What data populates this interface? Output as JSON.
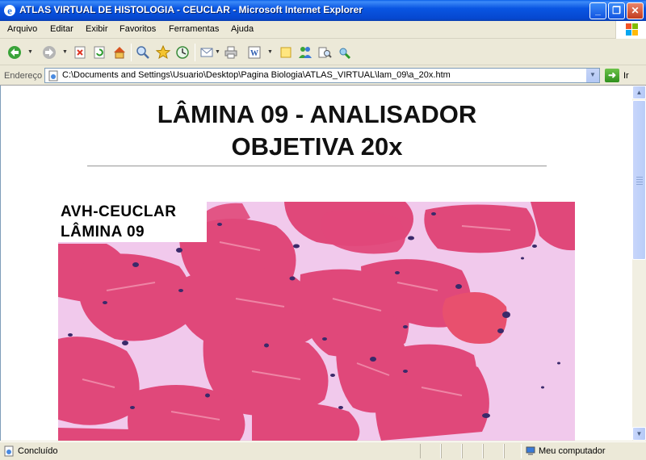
{
  "window": {
    "title": "ATLAS VIRTUAL DE HISTOLOGIA - CEUCLAR - Microsoft Internet Explorer",
    "minimize_glyph": "_",
    "maximize_glyph": "❐",
    "close_glyph": "✕"
  },
  "menu": {
    "items": [
      "Arquivo",
      "Editar",
      "Exibir",
      "Favoritos",
      "Ferramentas",
      "Ajuda"
    ]
  },
  "toolbar": {
    "icons": [
      "back-icon",
      "forward-icon",
      "stop-icon",
      "refresh-icon",
      "home-icon",
      "search-icon",
      "favorites-icon",
      "history-icon",
      "mail-icon",
      "print-icon",
      "edit-icon",
      "folder-icon",
      "messenger-icon",
      "research-icon",
      "tools-icon"
    ]
  },
  "address": {
    "label": "Endereço",
    "url": "C:\\Documents and Settings\\Usuario\\Desktop\\Pagina Biologia\\ATLAS_VIRTUAL\\lam_09\\a_20x.htm",
    "go_label": "Ir"
  },
  "page": {
    "heading_line1": "LÂMINA 09 - ANALISADOR",
    "heading_line2": "OBJETIVA 20x",
    "image_label_line1": "AVH-CEUCLAR",
    "image_label_line2": "LÂMINA 09"
  },
  "status": {
    "text": "Concluído",
    "zone": "Meu computador"
  },
  "colors": {
    "titlebar": "#0a5fe8",
    "chrome": "#ece9d8",
    "tissue_background": "#f0c8ea",
    "fiber": "#e0487a",
    "nucleus": "#3a2a6a"
  }
}
